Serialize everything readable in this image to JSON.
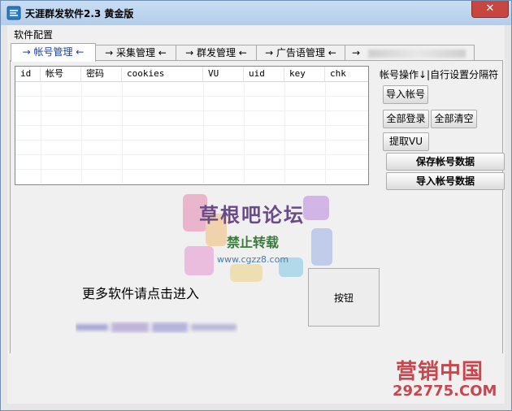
{
  "window": {
    "title": "天涯群发软件2.3 黄金版",
    "close_glyph": "✕"
  },
  "menu": {
    "item": "软件配置"
  },
  "tabs": [
    {
      "label": "→ 帐号管理 ←"
    },
    {
      "label": "→ 采集管理 ←"
    },
    {
      "label": "→ 群发管理 ←"
    },
    {
      "label": "→ 广告语管理 ←"
    },
    {
      "label": "→"
    }
  ],
  "grid": {
    "columns": [
      "id",
      "帐号",
      "密码",
      "cookies",
      "VU",
      "uid",
      "key",
      "chk"
    ],
    "rows": []
  },
  "side": {
    "label": "帐号操作↓|自行设置分隔符",
    "import_account": "导入帐号",
    "login_all": "全部登录",
    "clear_all": "全部清空",
    "fetch_vu": "提取VU",
    "save_data": "保存帐号数据",
    "import_data": "导入帐号数据"
  },
  "main": {
    "more_text": "更多软件请点击进入",
    "button": "按钮"
  },
  "watermark": {
    "title": "草根吧论坛",
    "sub": "禁止转载",
    "url": "www.cgzz8.com"
  },
  "corner_logo": {
    "title": "营销中国",
    "url": "292775.COM"
  },
  "colors": {
    "title_bar": "#b4cde9",
    "close": "#c7463f",
    "active_tab_text": "#1a3e9e"
  }
}
